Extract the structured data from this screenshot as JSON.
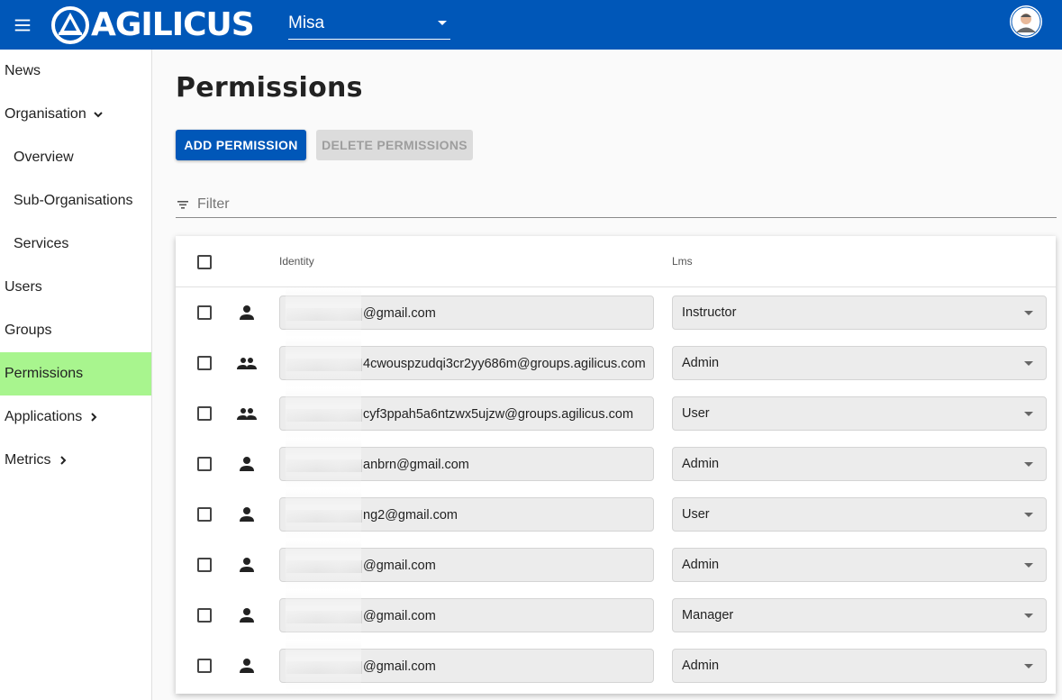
{
  "header": {
    "logo_text": "AGILICUS",
    "org_select_value": "Misa",
    "colors": {
      "bar": "#0057b8",
      "active_nav": "#a8f58e"
    }
  },
  "sidebar": {
    "items": [
      {
        "label": "News"
      },
      {
        "label": "Organisation"
      },
      {
        "label": "Overview"
      },
      {
        "label": "Sub-Organisations"
      },
      {
        "label": "Services"
      },
      {
        "label": "Users"
      },
      {
        "label": "Groups"
      },
      {
        "label": "Permissions"
      },
      {
        "label": "Applications"
      },
      {
        "label": "Metrics"
      }
    ]
  },
  "main": {
    "title": "Permissions",
    "add_button": "ADD PERMISSION",
    "delete_button": "DELETE PERMISSIONS",
    "filter_placeholder": "Filter",
    "table": {
      "headers": {
        "identity": "Identity",
        "lms": "Lms"
      },
      "rows": [
        {
          "type": "person-icon",
          "identity": "@gmail.com",
          "lms": "Instructor"
        },
        {
          "type": "group-icon",
          "identity": "4cwouspzudqi3cr2yy686m@groups.agilicus.com",
          "lms": "Admin"
        },
        {
          "type": "group-icon",
          "identity": "cyf3ppah5a6ntzwx5ujzw@groups.agilicus.com",
          "lms": "User"
        },
        {
          "type": "person-icon",
          "identity": "anbrn@gmail.com",
          "lms": "Admin"
        },
        {
          "type": "person-icon",
          "identity": "ng2@gmail.com",
          "lms": "User"
        },
        {
          "type": "person-icon",
          "identity": "@gmail.com",
          "lms": "Admin"
        },
        {
          "type": "person-icon",
          "identity": "@gmail.com",
          "lms": "Manager"
        },
        {
          "type": "person-icon",
          "identity": "@gmail.com",
          "lms": "Admin"
        }
      ]
    }
  }
}
